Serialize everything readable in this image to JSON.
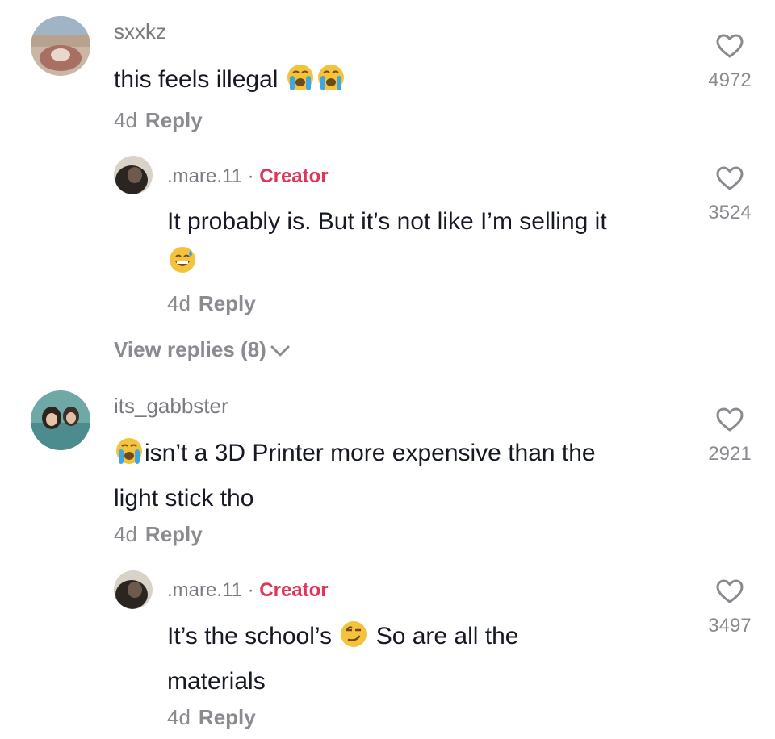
{
  "comments": [
    {
      "username": "sxxkz",
      "text": "this feels illegal",
      "emojis": [
        "loudly-crying-face",
        "loudly-crying-face"
      ],
      "age": "4d",
      "reply_label": "Reply",
      "likes": "4972",
      "view_replies": "View replies (8)",
      "reply": {
        "username": ".mare.11",
        "separator": "·",
        "badge": "Creator",
        "text": "It probably is. But it’s not like I’m selling it",
        "emoji": "grinning-face-with-sweat",
        "age": "4d",
        "reply_label": "Reply",
        "likes": "3524"
      }
    },
    {
      "username": "its_gabbster",
      "emoji": "loudly-crying-face",
      "text_line1": "isn’t a 3D Printer more expensive than the",
      "text_line2": "light stick tho",
      "age": "4d",
      "reply_label": "Reply",
      "likes": "2921",
      "reply": {
        "username": ".mare.11",
        "separator": "·",
        "badge": "Creator",
        "text_part1": "It’s the school’s",
        "emoji": "smirking-face",
        "text_part2": "So are all the",
        "text_line2": "materials",
        "age": "4d",
        "reply_label": "Reply",
        "likes": "3497"
      }
    }
  ],
  "colors": {
    "text": "#161823",
    "muted": "#8a8b91",
    "creator": "#e0345a",
    "background": "#ffffff"
  }
}
